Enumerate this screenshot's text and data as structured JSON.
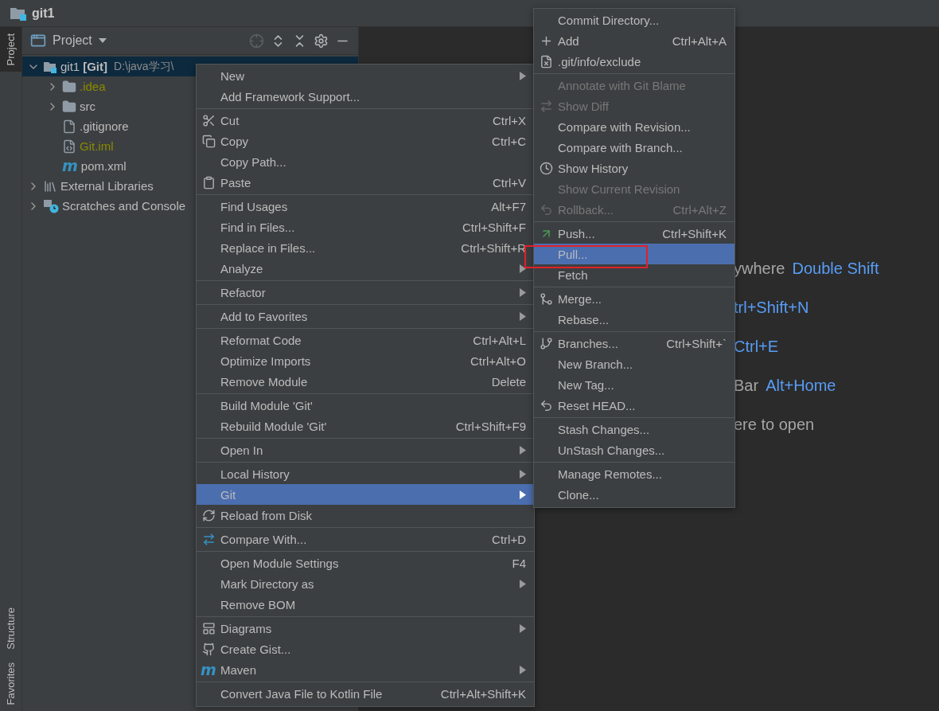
{
  "window": {
    "title": "git1"
  },
  "left_stripe": {
    "top": [
      {
        "label": "Project",
        "selected": true
      }
    ],
    "bottom": [
      {
        "label": "Structure",
        "selected": false
      },
      {
        "label": "Favorites",
        "selected": false
      }
    ]
  },
  "project_panel": {
    "title": "Project",
    "tree": [
      {
        "name": "git1",
        "tag": "[Git]",
        "path": "D:\\java学习\\",
        "kind": "module",
        "expanded": true,
        "selected": true,
        "children": [
          {
            "name": ".idea",
            "kind": "folder",
            "expanded": false,
            "ignored": true
          },
          {
            "name": "src",
            "kind": "folder",
            "expanded": false,
            "ignored": false
          },
          {
            "name": ".gitignore",
            "kind": "ignore-file",
            "ignored": false
          },
          {
            "name": "Git.iml",
            "kind": "iml-file",
            "ignored": true
          },
          {
            "name": "pom.xml",
            "kind": "maven-file",
            "icon_text": "m",
            "ignored": false
          }
        ]
      },
      {
        "name": "External Libraries",
        "kind": "libraries",
        "expanded": false,
        "selected": false
      },
      {
        "name": "Scratches and Console",
        "kind": "scratches",
        "expanded": false,
        "selected": false
      }
    ]
  },
  "editor_hints": [
    {
      "text": "ywhere",
      "shortcut": "Double Shift"
    },
    {
      "shortcut": "trl+Shift+N"
    },
    {
      "shortcut": "Ctrl+E"
    },
    {
      "text": "Bar",
      "shortcut": "Alt+Home"
    },
    {
      "text": "ere to open"
    }
  ],
  "context_menu": {
    "groups": [
      [
        {
          "label": "New",
          "submenu": true,
          "selected": false
        },
        {
          "label": "Add Framework Support...",
          "selected": false
        }
      ],
      [
        {
          "label": "Cut",
          "shortcut": "Ctrl+X",
          "selected": false
        },
        {
          "label": "Copy",
          "shortcut": "Ctrl+C",
          "selected": false
        },
        {
          "label": "Copy Path...",
          "selected": false
        },
        {
          "label": "Paste",
          "shortcut": "Ctrl+V",
          "selected": false
        }
      ],
      [
        {
          "label": "Find Usages",
          "shortcut": "Alt+F7",
          "selected": false
        },
        {
          "label": "Find in Files...",
          "shortcut": "Ctrl+Shift+F",
          "selected": false
        },
        {
          "label": "Replace in Files...",
          "shortcut": "Ctrl+Shift+R",
          "selected": false
        },
        {
          "label": "Analyze",
          "submenu": true,
          "selected": false
        }
      ],
      [
        {
          "label": "Refactor",
          "submenu": true,
          "selected": false
        }
      ],
      [
        {
          "label": "Add to Favorites",
          "submenu": true,
          "selected": false
        }
      ],
      [
        {
          "label": "Reformat Code",
          "shortcut": "Ctrl+Alt+L",
          "selected": false
        },
        {
          "label": "Optimize Imports",
          "shortcut": "Ctrl+Alt+O",
          "selected": false
        },
        {
          "label": "Remove Module",
          "shortcut": "Delete",
          "selected": false
        }
      ],
      [
        {
          "label": "Build Module 'Git'",
          "selected": false
        },
        {
          "label": "Rebuild Module 'Git'",
          "shortcut": "Ctrl+Shift+F9",
          "selected": false
        }
      ],
      [
        {
          "label": "Open In",
          "submenu": true,
          "selected": false
        }
      ],
      [
        {
          "label": "Local History",
          "submenu": true,
          "selected": false
        },
        {
          "label": "Git",
          "submenu": true,
          "selected": true
        },
        {
          "label": "Reload from Disk",
          "selected": false
        }
      ],
      [
        {
          "label": "Compare With...",
          "shortcut": "Ctrl+D",
          "selected": false
        }
      ],
      [
        {
          "label": "Open Module Settings",
          "shortcut": "F4",
          "selected": false
        },
        {
          "label": "Mark Directory as",
          "submenu": true,
          "selected": false
        },
        {
          "label": "Remove BOM",
          "selected": false
        }
      ],
      [
        {
          "label": "Diagrams",
          "submenu": true,
          "selected": false
        },
        {
          "label": "Create Gist...",
          "selected": false
        },
        {
          "label": "Maven",
          "submenu": true,
          "icon_text": "m",
          "selected": false
        }
      ],
      [
        {
          "label": "Convert Java File to Kotlin File",
          "shortcut": "Ctrl+Alt+Shift+K",
          "selected": false
        }
      ]
    ]
  },
  "git_submenu": {
    "groups": [
      [
        {
          "label": "Commit Directory...",
          "selected": false
        },
        {
          "label": "Add",
          "shortcut": "Ctrl+Alt+A",
          "selected": false
        },
        {
          "label": ".git/info/exclude",
          "selected": false
        }
      ],
      [
        {
          "label": "Annotate with Git Blame",
          "disabled": true,
          "selected": false
        },
        {
          "label": "Show Diff",
          "disabled": true,
          "selected": false
        },
        {
          "label": "Compare with Revision...",
          "disabled": false,
          "selected": false
        },
        {
          "label": "Compare with Branch...",
          "disabled": false,
          "selected": false
        },
        {
          "label": "Show History",
          "disabled": false,
          "selected": false
        },
        {
          "label": "Show Current Revision",
          "disabled": true,
          "selected": false
        },
        {
          "label": "Rollback...",
          "shortcut": "Ctrl+Alt+Z",
          "disabled": true,
          "selected": false
        }
      ],
      [
        {
          "label": "Push...",
          "shortcut": "Ctrl+Shift+K",
          "selected": false
        },
        {
          "label": "Pull...",
          "selected": true,
          "annotated": true
        },
        {
          "label": "Fetch",
          "selected": false
        }
      ],
      [
        {
          "label": "Merge...",
          "selected": false
        },
        {
          "label": "Rebase...",
          "selected": false
        }
      ],
      [
        {
          "label": "Branches...",
          "shortcut": "Ctrl+Shift+`",
          "selected": false
        },
        {
          "label": "New Branch...",
          "selected": false
        },
        {
          "label": "New Tag...",
          "selected": false
        },
        {
          "label": "Reset HEAD...",
          "selected": false
        }
      ],
      [
        {
          "label": "Stash Changes...",
          "selected": false
        },
        {
          "label": "UnStash Changes...",
          "selected": false
        }
      ],
      [
        {
          "label": "Manage Remotes...",
          "selected": false
        },
        {
          "label": "Clone...",
          "selected": false
        }
      ]
    ]
  }
}
